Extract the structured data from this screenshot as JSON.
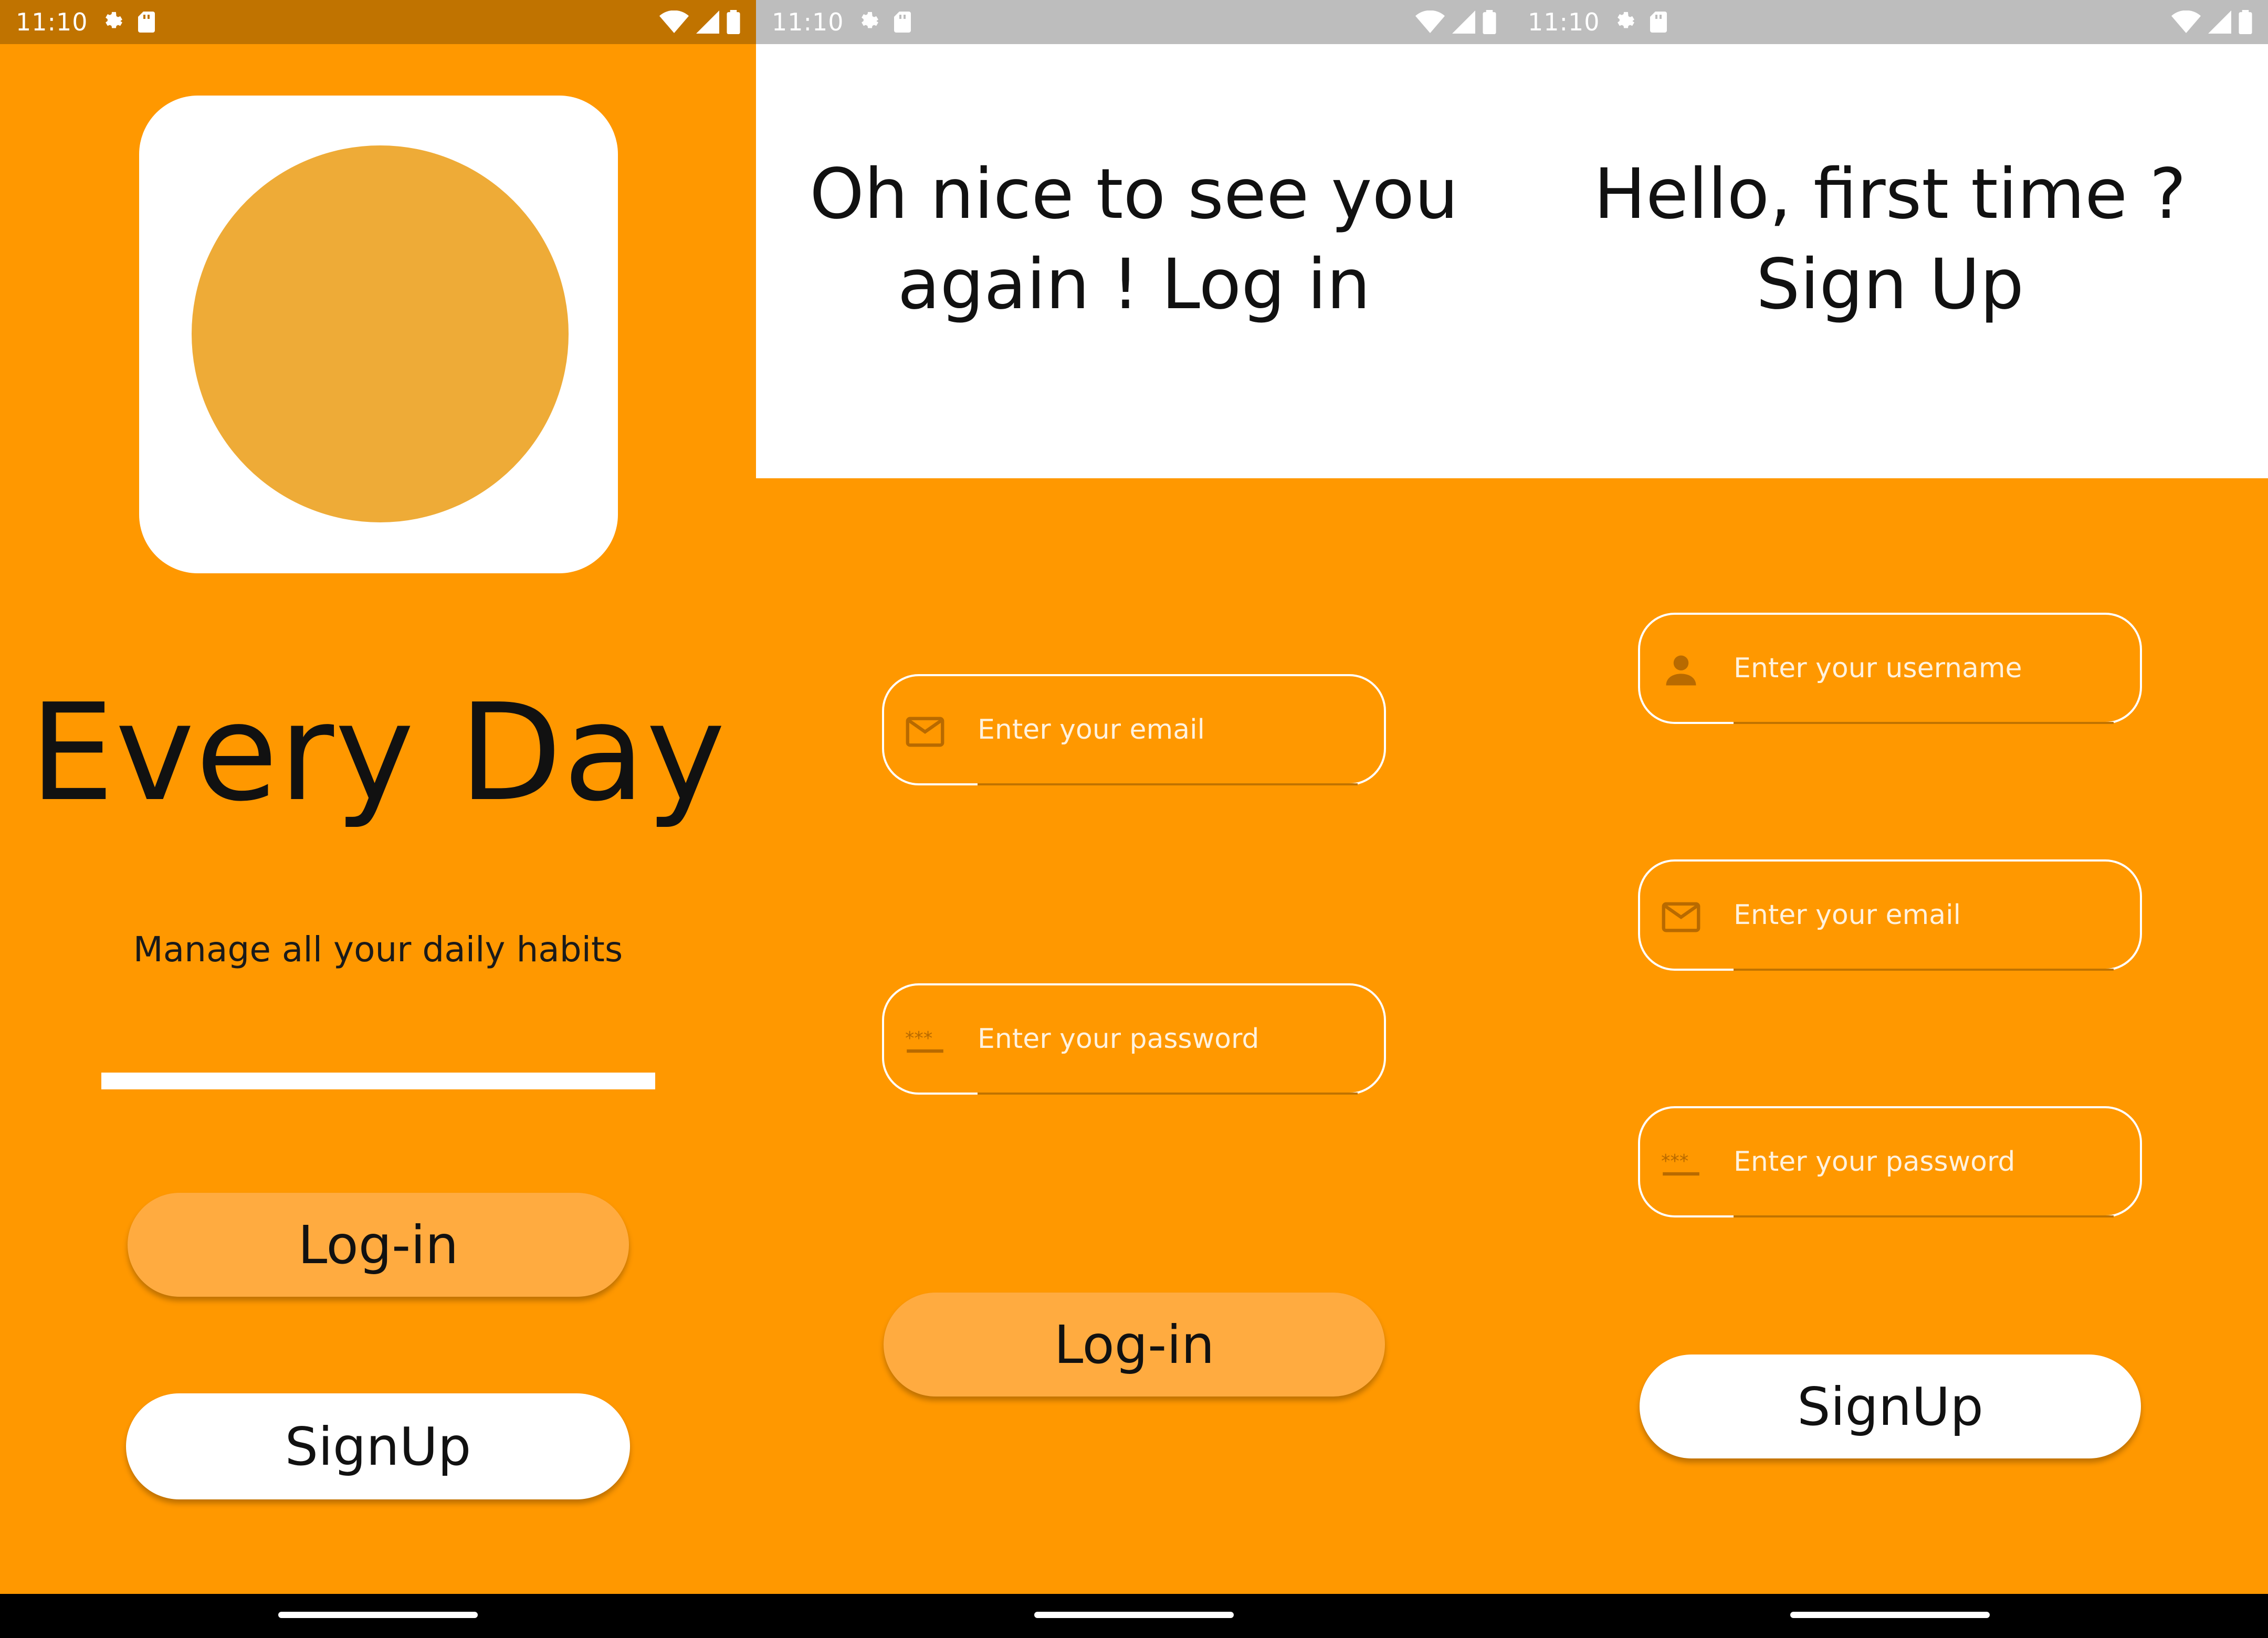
{
  "status_bar": {
    "time": "11:10"
  },
  "welcome": {
    "app_title": "Every Day",
    "tagline": "Manage all your daily habits",
    "login_label": "Log-in",
    "signup_label": "SignUp"
  },
  "login": {
    "title_line1": "Oh nice to see you",
    "title_line2": "again ! Log in",
    "email_placeholder": "Enter your email",
    "password_placeholder": "Enter your password",
    "login_label": "Log-in"
  },
  "signup": {
    "title_line1": "Hello, first time ?",
    "title_line2": "Sign Up",
    "username_placeholder": "Enter your username",
    "email_placeholder": "Enter your email",
    "password_placeholder": "Enter your password",
    "signup_label": "SignUp"
  },
  "colors": {
    "background": "#FF9800",
    "status_bar_welcome": "#C07300",
    "status_bar_forms": "#BDBDBD",
    "logo_circle": "#EEAB37",
    "login_button": "#FFAB40",
    "signup_button": "#FFFFFF"
  },
  "icons": [
    "settings-gear-icon",
    "sd-card-icon",
    "wifi-icon",
    "cell-signal-icon",
    "battery-icon",
    "email-icon",
    "password-icon",
    "person-icon"
  ]
}
